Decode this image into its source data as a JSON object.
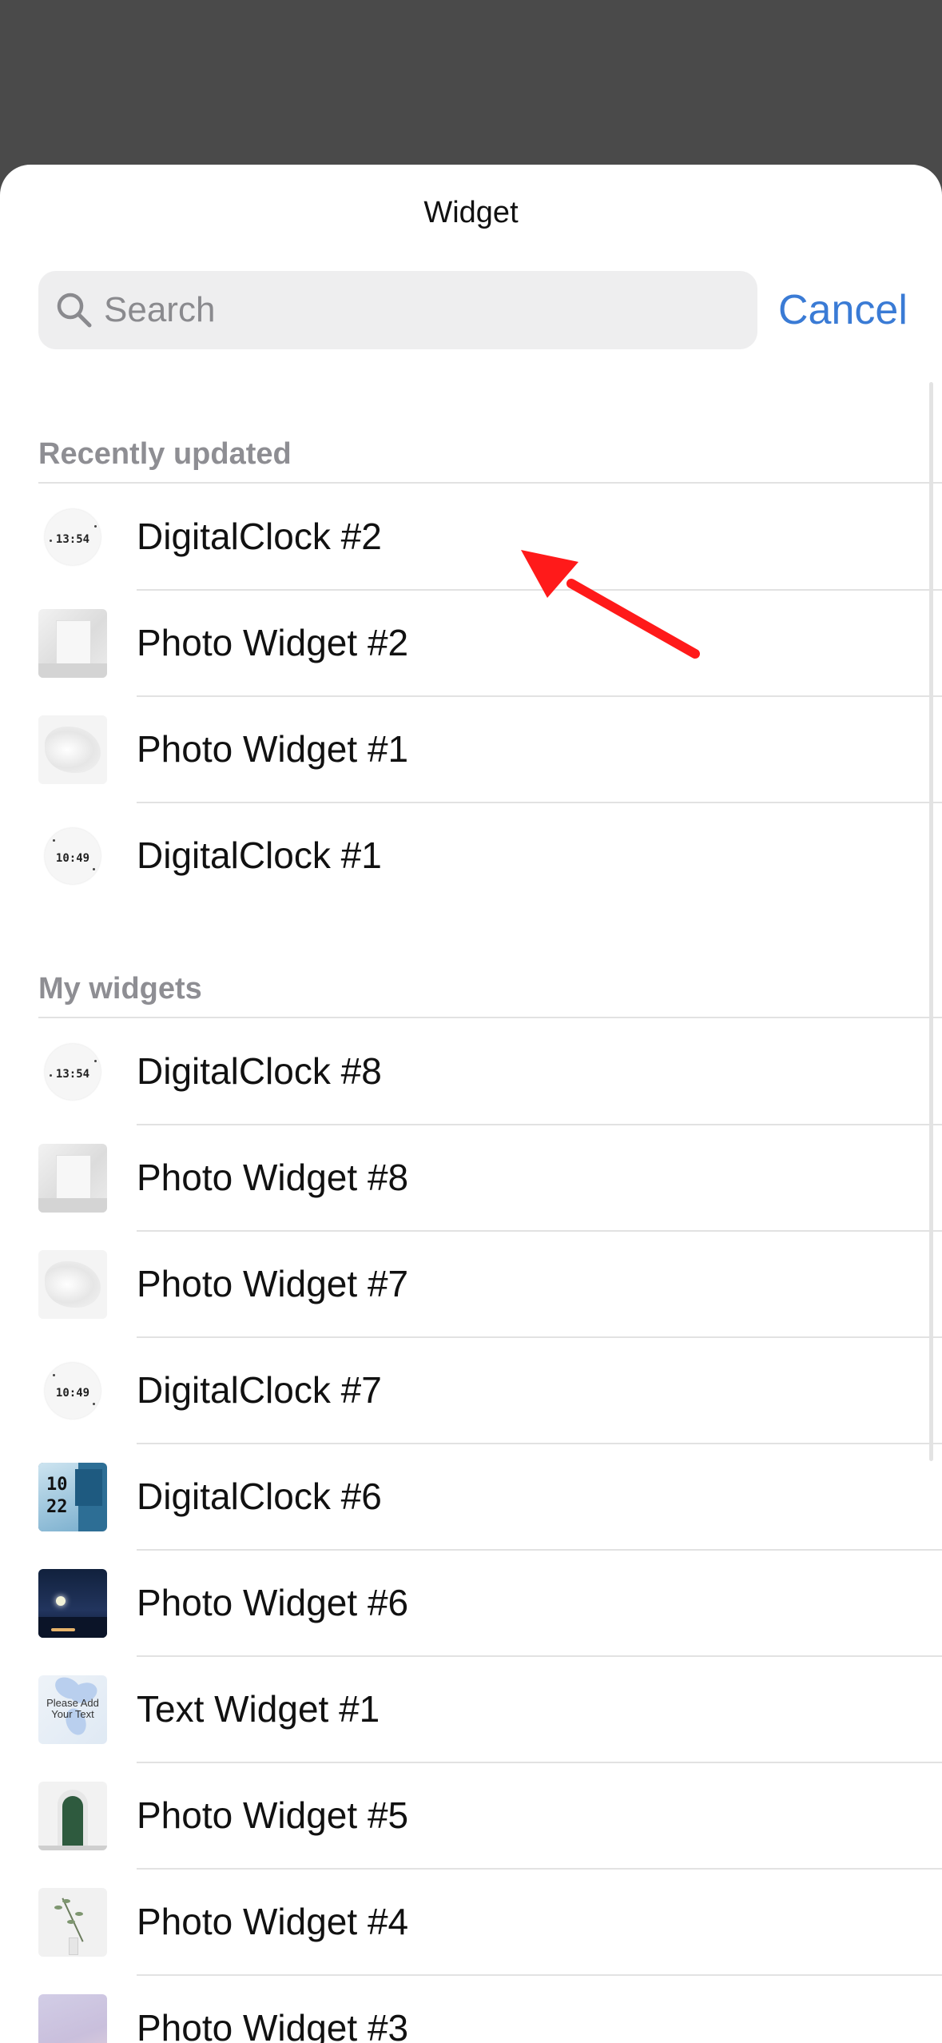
{
  "sheet": {
    "title": "Widget"
  },
  "search": {
    "placeholder": "Search",
    "value": "",
    "cancel_label": "Cancel"
  },
  "sections": [
    {
      "header": "Recently updated",
      "items": [
        {
          "label": "DigitalClock #2",
          "thumb": "clock",
          "clock_text": "13:54"
        },
        {
          "label": "Photo Widget #2",
          "thumb": "room"
        },
        {
          "label": "Photo Widget #1",
          "thumb": "silk"
        },
        {
          "label": "DigitalClock #1",
          "thumb": "clock",
          "clock_text": "10:49"
        }
      ]
    },
    {
      "header": "My widgets",
      "items": [
        {
          "label": "DigitalClock #8",
          "thumb": "clock",
          "clock_text": "13:54"
        },
        {
          "label": "Photo Widget #8",
          "thumb": "room"
        },
        {
          "label": "Photo Widget #7",
          "thumb": "silk"
        },
        {
          "label": "DigitalClock #7",
          "thumb": "clock",
          "clock_text": "10:49"
        },
        {
          "label": "DigitalClock #6",
          "thumb": "blue-clock",
          "clock_text": "10 22"
        },
        {
          "label": "Photo Widget #6",
          "thumb": "moon"
        },
        {
          "label": "Text Widget #1",
          "thumb": "flower",
          "thumb_text": "Please Add Your Text"
        },
        {
          "label": "Photo Widget #5",
          "thumb": "door"
        },
        {
          "label": "Photo Widget #4",
          "thumb": "plant"
        },
        {
          "label": "Photo Widget #3",
          "thumb": "lilac"
        }
      ]
    }
  ],
  "colors": {
    "accent": "#3a7bd5",
    "annotation_arrow": "#ff1a1a",
    "backdrop": "#4a4a4a"
  }
}
